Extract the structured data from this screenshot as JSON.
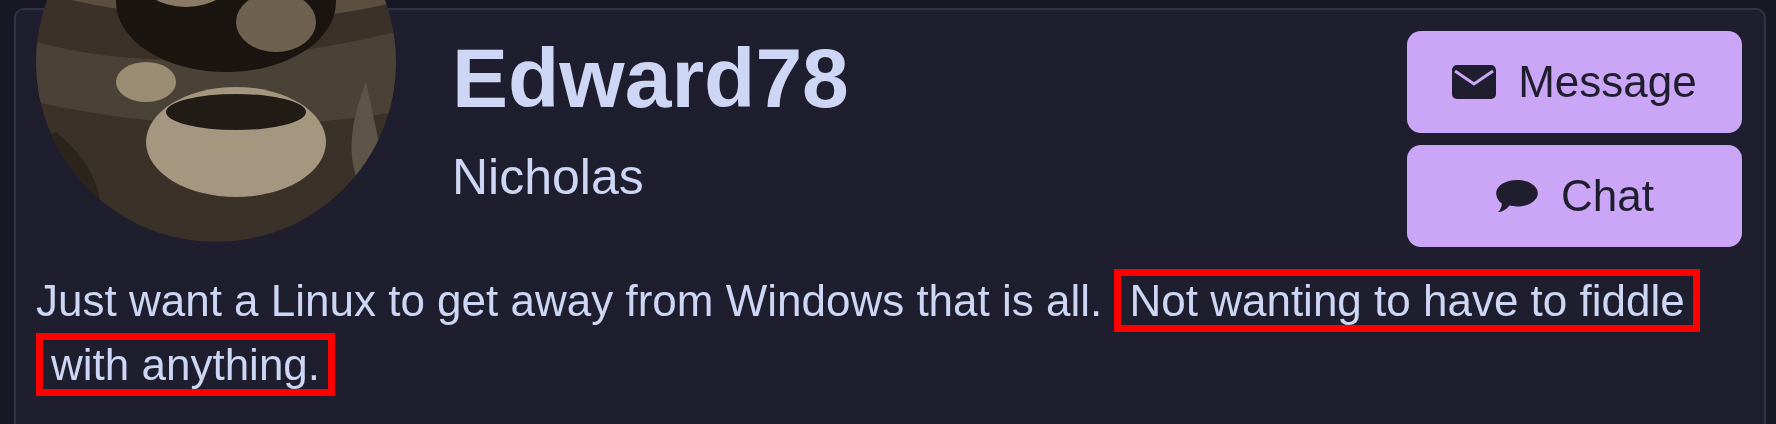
{
  "profile": {
    "username": "Edward78",
    "display_name": "Nicholas"
  },
  "buttons": [
    {
      "kind": "message",
      "label": "Message"
    },
    {
      "kind": "chat",
      "label": "Chat"
    }
  ],
  "bio": [
    {
      "text": "Just want a Linux to get away from Windows that is all.",
      "highlighted": false
    },
    {
      "text": "Not wanting to have to fiddle with anything.",
      "highlighted": true
    }
  ]
}
